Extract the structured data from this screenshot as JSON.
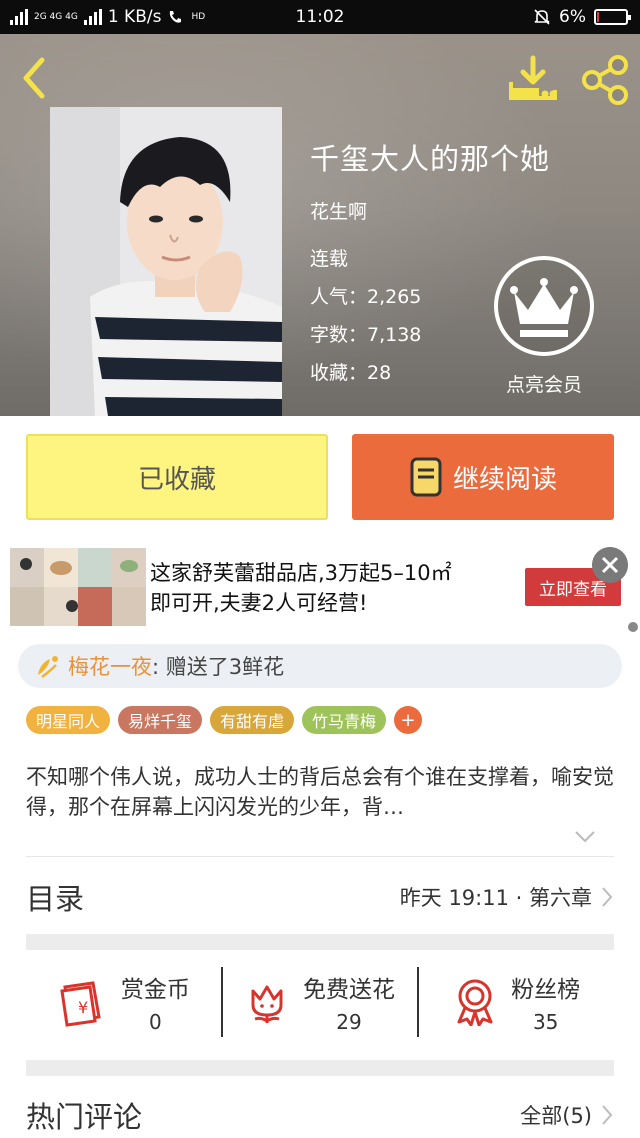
{
  "status_bar": {
    "network": "2G 4G 4G",
    "speed": "1 KB/s",
    "hd": "HD",
    "time": "11:02",
    "battery": "6%",
    "battery_level": 0.06
  },
  "book": {
    "title": "千玺大人的那个她",
    "author": "花生啊",
    "status": "连载",
    "popularity": "人气：2,265",
    "word_count": "字数：7,138",
    "favorites": "收藏：28"
  },
  "vip": {
    "label": "点亮会员"
  },
  "actions": {
    "collected": "已收藏",
    "continue_read": "继续阅读"
  },
  "ad": {
    "line1": "这家舒芙蕾甜品店,3万起5–10㎡",
    "line2": "即可开,夫妻2人可经营!",
    "cta": "立即查看"
  },
  "flower": {
    "user": "梅花一夜",
    "message": ":  赠送了3鲜花"
  },
  "tags": [
    {
      "label": "明星同人",
      "color": "#f2b23f"
    },
    {
      "label": "易烊千玺",
      "color": "#c97760"
    },
    {
      "label": "有甜有虐",
      "color": "#d9a63a"
    },
    {
      "label": "竹马青梅",
      "color": "#9fc35b"
    }
  ],
  "tag_add": "+",
  "intro": "  不知哪个伟人说，成功人士的背后总会有个谁在支撑着，喻安觉得，那个在屏幕上闪闪发光的少年，背…",
  "toc": {
    "title": "目录",
    "latest": "昨天 19:11 · 第六章"
  },
  "rewards": [
    {
      "title": "赏金币",
      "value": "0"
    },
    {
      "title": "免费送花",
      "value": "29"
    },
    {
      "title": "粉丝榜",
      "value": "35"
    }
  ],
  "comments": {
    "title": "热门评论",
    "all": "全部(5)"
  },
  "colors": {
    "accent": "#ec6b3d",
    "collect_yellow": "#fef480",
    "reward_red": "#d9342b"
  }
}
